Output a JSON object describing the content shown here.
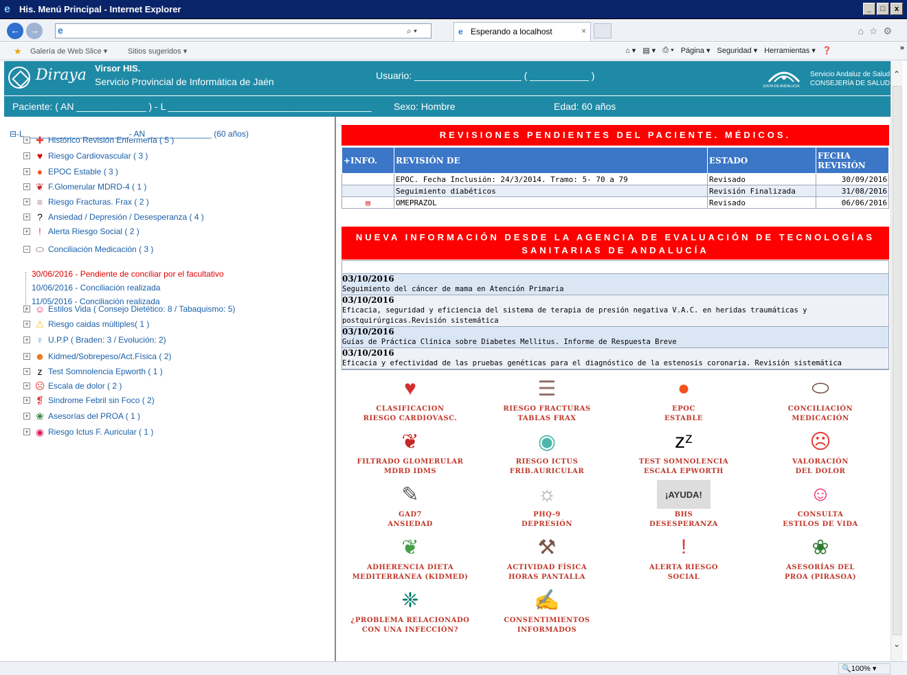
{
  "window": {
    "title": "His. Menú Principal - Internet Explorer",
    "buttons": [
      "_",
      "□",
      "x"
    ]
  },
  "browser": {
    "address_value": "",
    "search_label": "⌕ ▾",
    "tab_title": "Esperando a localhost",
    "tab_close": "×",
    "favorites": [
      "Galería de Web Slice ▾",
      "Sitios sugeridos ▾"
    ],
    "commands": [
      "Página ▾",
      "Seguridad ▾",
      "Herramientas ▾"
    ],
    "right_icons": "⌂☆⚙",
    "zoom": "100%"
  },
  "header": {
    "app_name": "Diraya",
    "product": "Virsor HIS.",
    "service": "Servicio Provincial de Informática de Jaén",
    "user_label": "Usuario: ____________________ ( ___________ )",
    "sas_line1": "Servicio Andaluz de Salud",
    "sas_line2": "CONSEJERÍA DE SALUD",
    "sas_caption": "JUNTA DE ANDALUCIA"
  },
  "patient": {
    "label": "Paciente: ( AN _____________ ) - L ______________________________________",
    "sex": "Sexo: Hombre",
    "age": "Edad: 60 años"
  },
  "tree": {
    "root": "⊟-L ______________________ - AN ______________ (60 años)",
    "items": [
      {
        "label": "Histórico Revisión Enfermería ( 5 )",
        "icon": "nurse-icon",
        "sym": "✚",
        "color": "#e53935",
        "pm": "+"
      },
      {
        "label": "Riesgo Cardiovascular ( 3 )",
        "icon": "heart-icon",
        "sym": "♥",
        "color": "#d50000",
        "pm": "+"
      },
      {
        "label": "EPOC Estable ( 3 )",
        "icon": "lungs-icon",
        "sym": "●",
        "color": "#f4511e",
        "pm": "+"
      },
      {
        "label": "F.Glomerular MDRD-4 ( 1 )",
        "icon": "kidney-icon",
        "sym": "❦",
        "color": "#c62828",
        "pm": "+"
      },
      {
        "label": "Riesgo Fracturas. Frax ( 2 )",
        "icon": "spine-icon",
        "sym": "≡",
        "color": "#a1887f",
        "pm": "+"
      },
      {
        "label": "Ansiedad / Depresión / Desesperanza ( 4 )",
        "icon": "question-icon",
        "sym": "?",
        "color": "#000000",
        "pm": "+"
      },
      {
        "label": "Alerta Riesgo Social ( 2 )",
        "icon": "alert-icon",
        "sym": "!",
        "color": "#e53935",
        "pm": "+"
      },
      {
        "label": "Conciliación Medicación ( 3 )",
        "icon": "pills-icon",
        "sym": "⬭",
        "color": "#6d4c41",
        "pm": "−"
      },
      {
        "label": "Estilos Vida ( Consejo Dietético: 8 / Tabaquismo: 5)",
        "icon": "lifestyle-icon",
        "sym": "☺",
        "color": "#e91e63",
        "pm": "+"
      },
      {
        "label": "Riesgo caidas múltiples( 1 )",
        "icon": "warning-icon",
        "sym": "⚠",
        "color": "#fbc02d",
        "pm": "+"
      },
      {
        "label": "U.P.P ( Braden: 3 / Evolución: 2)",
        "icon": "person-icon",
        "sym": "♀",
        "color": "#1e88e5",
        "pm": "+"
      },
      {
        "label": "Kidmed/Sobrepeso/Act.Física ( 2)",
        "icon": "child-icon",
        "sym": "☻",
        "color": "#ef6c00",
        "pm": "+"
      },
      {
        "label": "Test Somnolencia Epworth ( 1 )",
        "icon": "sleep-icon",
        "sym": "z",
        "color": "#000000",
        "pm": "+"
      },
      {
        "label": "Escala de dolor ( 2 )",
        "icon": "sad-face-icon",
        "sym": "☹",
        "color": "#e53935",
        "pm": "+"
      },
      {
        "label": "Sindrome Febril sin Foco ( 2)",
        "icon": "thermometer-icon",
        "sym": "❡",
        "color": "#e53935",
        "pm": "+"
      },
      {
        "label": "Asesorías del PROA ( 1 )",
        "icon": "virus-icon",
        "sym": "❀",
        "color": "#2e7d32",
        "pm": "+"
      },
      {
        "label": "Riesgo Ictus F. Auricular ( 1 )",
        "icon": "brain-icon",
        "sym": "◉",
        "color": "#d81b60",
        "pm": "+"
      }
    ],
    "sub_items": [
      {
        "label": "30/06/2016 - Pendiente de conciliar por el facultativo",
        "red": true
      },
      {
        "label": "10/06/2016 - Conciliación realizada",
        "red": false
      },
      {
        "label": "11/05/2016 - Conciliación realizada",
        "red": false
      }
    ]
  },
  "revisiones": {
    "title": "REVISIONES PENDIENTES DEL PACIENTE. MÉDICOS.",
    "headers": [
      "+INFO.",
      "REVISIÓN DE",
      "ESTADO",
      "FECHA REVISIÓN"
    ],
    "rows": [
      {
        "info": "",
        "revision": "EPOC. Fecha Inclusión: 24/3/2014. Tramo: 5- 70 a 79",
        "estado": "Revisado",
        "fecha": "30/09/2016"
      },
      {
        "info": "",
        "revision": "Seguimiento diabéticos",
        "estado": "Revisión Finalizada",
        "fecha": "31/08/2016"
      },
      {
        "info": "▤",
        "revision": "OMEPRAZOL",
        "estado": "Revisado",
        "fecha": "06/06/2016"
      }
    ]
  },
  "noticias": {
    "title_line1": "NUEVA INFORMACIÓN DESDE LA AGENCIA DE EVALUACIÓN DE TECNOLOGÍAS",
    "title_line2": "SANITARIAS DE ANDALUCÍA",
    "items": [
      {
        "date": "03/10/2016",
        "text": "Seguimiento del cáncer de mama en Atención Primaria"
      },
      {
        "date": "03/10/2016",
        "text": "Eficacia, seguridad y eficiencia del sistema de terapia de presión negativa V.A.C. en heridas traumáticas y postquirúrgicas.Revisión sistemática"
      },
      {
        "date": "03/10/2016",
        "text": "Guías de Práctica Clínica sobre Diabetes Mellitus. Informe de Respuesta Breve"
      },
      {
        "date": "03/10/2016",
        "text": "Eficacia y efectividad de las pruebas genéticas para el diagnóstico de la estenosis coronaria. Revisión sistemática"
      }
    ]
  },
  "tiles": [
    {
      "l1": "CLASIFICACION",
      "l2": "RIESGO CARDIOVASC.",
      "icon": "stethoscope-heart-icon",
      "sym": "♥",
      "color": "#d32f2f"
    },
    {
      "l1": "RIESGO FRACTURAS",
      "l2": "TABLAS FRAX",
      "icon": "spine-icon",
      "sym": "☰",
      "color": "#8d6e63"
    },
    {
      "l1": "EPOC",
      "l2": "ESTABLE",
      "icon": "lungs-icon",
      "sym": "●",
      "color": "#f4511e"
    },
    {
      "l1": "CONCILIACIÓN",
      "l2": "MEDICACIÓN",
      "icon": "pills-icon",
      "sym": "⬭",
      "color": "#6d4c41"
    },
    {
      "l1": "FILTRADO GLOMERULAR",
      "l2": "MDRD IDMS",
      "icon": "kidney-icon",
      "sym": "❦",
      "color": "#c62828"
    },
    {
      "l1": "RIESGO ICTUS",
      "l2": "FRIB.AURICULAR",
      "icon": "brain-icon",
      "sym": "◉",
      "color": "#4db6ac"
    },
    {
      "l1": "TEST SOMNOLENCIA",
      "l2": "ESCALA EPWORTH",
      "icon": "sleep-icon",
      "sym": "zᶻ",
      "color": "#000000"
    },
    {
      "l1": "VALORACIÓN",
      "l2": "DEL DOLOR",
      "icon": "sad-face-icon",
      "sym": "☹",
      "color": "#e53935"
    },
    {
      "l1": "GAD7",
      "l2": "ANSIEDAD",
      "icon": "note-icon",
      "sym": "✎",
      "color": "#555555"
    },
    {
      "l1": "PHQ-9",
      "l2": "DEPRESIÓN",
      "icon": "depression-icon",
      "sym": "☼",
      "color": "#9e9e9e"
    },
    {
      "l1": "BHS",
      "l2": "DESESPERANZA",
      "icon": "ayuda-icon",
      "sym": "¡AYUDA!",
      "color": "#333333"
    },
    {
      "l1": "CONSULTA",
      "l2": "ESTILOS DE VIDA",
      "icon": "lifestyle-icon",
      "sym": "☺",
      "color": "#e91e63"
    },
    {
      "l1": "ADHERENCIA DIETA",
      "l2": "MEDITERRÁNEA (KIDMED)",
      "icon": "salad-icon",
      "sym": "❦",
      "color": "#43a047"
    },
    {
      "l1": "ACTIVIDAD FÍSICA",
      "l2": "HORAS PANTALLA",
      "icon": "activity-icon",
      "sym": "⚒",
      "color": "#795548"
    },
    {
      "l1": "ALERTA RIESGO",
      "l2": "SOCIAL",
      "icon": "alert-icon",
      "sym": "!",
      "color": "#e53935"
    },
    {
      "l1": "ASESORÍAS DEL",
      "l2": "PROA (PIRASOA)",
      "icon": "virus-icon",
      "sym": "❀",
      "color": "#2e7d32"
    },
    {
      "l1": "¿PROBLEMA RELACIONADO",
      "l2": "CON UNA INFECCIÓN?",
      "icon": "infection-icon",
      "sym": "❈",
      "color": "#00796b"
    },
    {
      "l1": "CONSENTIMIENTOS",
      "l2": "INFORMADOS",
      "icon": "document-pen-icon",
      "sym": "✍",
      "color": "#78909c"
    }
  ]
}
